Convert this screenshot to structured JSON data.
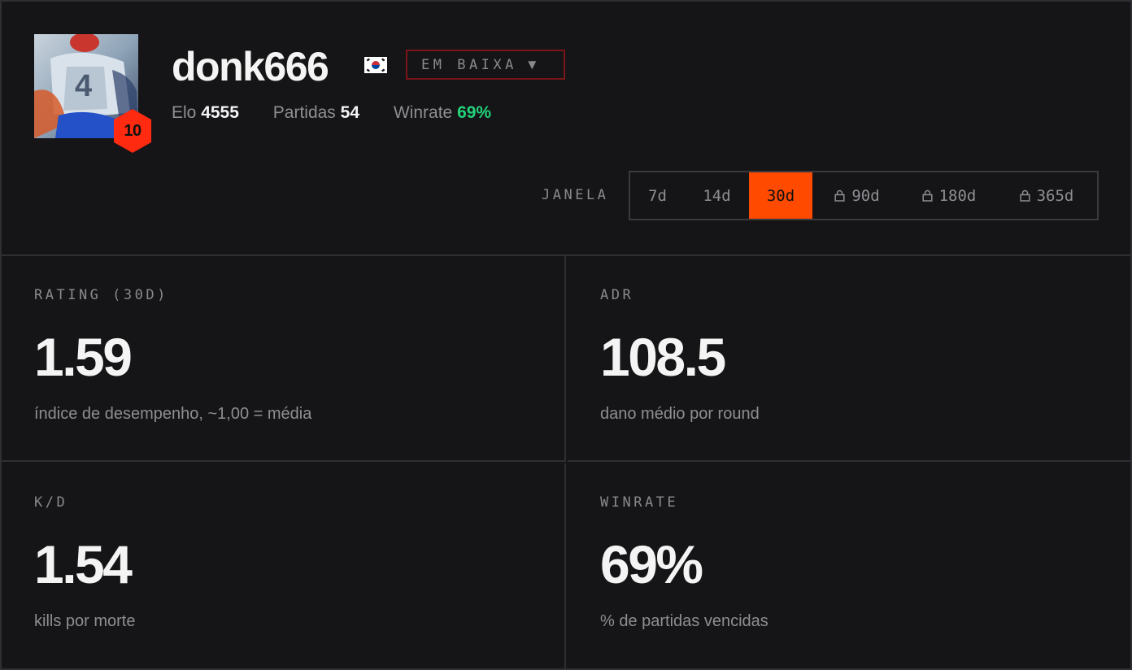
{
  "profile": {
    "username": "donk666",
    "country_flag": "south-korea-flag",
    "level": "10",
    "status_label": "EM BAIXA",
    "elo_label": "Elo",
    "elo_value": "4555",
    "matches_label": "Partidas",
    "matches_value": "54",
    "winrate_label": "Winrate",
    "winrate_value": "69%"
  },
  "window": {
    "label": "JANELA",
    "tabs": [
      {
        "label": "7d",
        "locked": false,
        "active": false
      },
      {
        "label": "14d",
        "locked": false,
        "active": false
      },
      {
        "label": "30d",
        "locked": false,
        "active": true
      },
      {
        "label": "90d",
        "locked": true,
        "active": false
      },
      {
        "label": "180d",
        "locked": true,
        "active": false
      },
      {
        "label": "365d",
        "locked": true,
        "active": false
      }
    ]
  },
  "stats": [
    {
      "caption": "RATING (30D)",
      "value": "1.59",
      "description": "índice de desempenho, ~1,00 = média"
    },
    {
      "caption": "ADR",
      "value": "108.5",
      "description": "dano médio por round"
    },
    {
      "caption": "K/D",
      "value": "1.54",
      "description": "kills por morte"
    },
    {
      "caption": "WINRATE",
      "value": "69%",
      "description": "% de partidas vencidas"
    }
  ],
  "colors": {
    "accent": "#ff4a00",
    "level_badge": "#ff2a10",
    "winrate_green": "#22d37a",
    "status_border": "#7a1418",
    "background": "#151517"
  }
}
